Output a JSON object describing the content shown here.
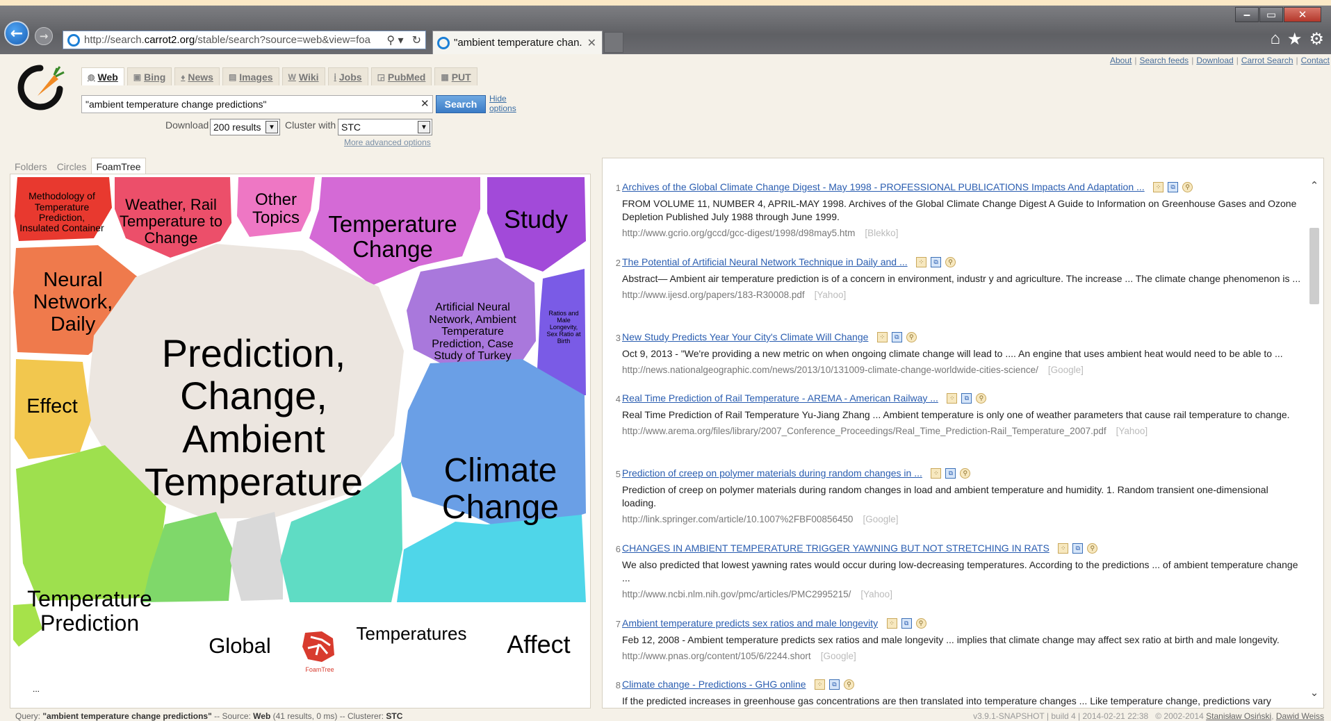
{
  "browser": {
    "address": "http://search.carrot2.org/stable/search?source=web&view=foa",
    "address_prefix": "http://search.",
    "address_host": "carrot2.org",
    "address_path": "/stable/search?source=web&view=foa",
    "tab_title": "\"ambient temperature chan...",
    "window_buttons": [
      "‒",
      "▭",
      "✕"
    ]
  },
  "top_links": [
    "About",
    "Search feeds",
    "Download",
    "Carrot Search",
    "Contact"
  ],
  "source_tabs": [
    {
      "label": "Web",
      "icon": "globe-icon",
      "active": true
    },
    {
      "label": "Bing",
      "icon": "bing-icon",
      "active": false
    },
    {
      "label": "News",
      "icon": "news-icon",
      "active": false
    },
    {
      "label": "Images",
      "icon": "images-icon",
      "active": false
    },
    {
      "label": "Wiki",
      "icon": "wiki-icon",
      "active": false
    },
    {
      "label": "Jobs",
      "icon": "jobs-icon",
      "active": false
    },
    {
      "label": "PubMed",
      "icon": "pubmed-icon",
      "active": false
    },
    {
      "label": "PUT",
      "icon": "put-icon",
      "active": false
    }
  ],
  "search": {
    "query": "\"ambient temperature change predictions\"",
    "button": "Search",
    "hide_options": "Hide options",
    "download_label": "Download",
    "download_value": "200 results",
    "cluster_label": "Cluster with",
    "cluster_value": "STC",
    "more_options": "More advanced options"
  },
  "view_tabs": [
    {
      "label": "Folders",
      "active": false
    },
    {
      "label": "Circles",
      "active": false
    },
    {
      "label": "FoamTree",
      "active": true
    }
  ],
  "foamtree": {
    "cells": [
      {
        "label": "Methodology of Temperature Prediction, Insulated Container",
        "color": "#e8392f"
      },
      {
        "label": "Weather, Rail Temperature to Change",
        "color": "#ec4f6a"
      },
      {
        "label": "Other Topics",
        "color": "#ee77c4"
      },
      {
        "label": "Temperature Change",
        "color": "#d46ad6"
      },
      {
        "label": "Study",
        "color": "#a24ad9"
      },
      {
        "label": "Neural Network, Daily",
        "color": "#ef7a4c"
      },
      {
        "label": "Prediction, Change, Ambient Temperature",
        "color": "#ece6e0"
      },
      {
        "label": "Artificial Neural Network, Ambient Temperature Prediction, Case Study of Turkey",
        "color": "#a978dc"
      },
      {
        "label": "Ratios and Male Longevity, Sex Ratio at Birth",
        "color": "#7a5be6"
      },
      {
        "label": "Effect",
        "color": "#f2c74e"
      },
      {
        "label": "Climate Change",
        "color": "#6a9fe6"
      },
      {
        "label": "Temperature Prediction",
        "color": "#9ee04e"
      },
      {
        "label": "Global",
        "color": "#7fd86a"
      },
      {
        "label": "Temperatures",
        "color": "#5fdcc4"
      },
      {
        "label": "Affect",
        "color": "#4fd6e9"
      },
      {
        "label": "...",
        "color": "#a6e24a"
      }
    ],
    "logo_text": "FoamTree"
  },
  "results": [
    {
      "num": "1",
      "title": "Archives of the Global Climate Change Digest - May 1998 - PROFESSIONAL PUBLICATIONS Impacts And Adaptation ...",
      "snippet": "FROM VOLUME 11, NUMBER 4, APRIL-MAY 1998. Archives of the Global Climate Change Digest A Guide to Information on Greenhouse Gases and Ozone Depletion Published July 1988 through June 1999.",
      "url": "http://www.gcrio.org/gccd/gcc-digest/1998/d98may5.htm",
      "source": "[Blekko]"
    },
    {
      "num": "2",
      "title": "The Potential of Artificial Neural Network Technique in Daily and ...",
      "snippet": "Abstract— Ambient air temperature prediction is of a concern in environment, industr y and agriculture. The increase ... The climate change phenomenon is ...",
      "url": "http://www.ijesd.org/papers/183-R30008.pdf",
      "source": "[Yahoo]"
    },
    {
      "num": "3",
      "title": "New Study Predicts Year Your City's Climate Will Change",
      "snippet": "Oct 9, 2013 - \"We're providing a new metric on when ongoing climate change will lead to .... An engine that uses ambient heat would need to be able to ...",
      "url": "http://news.nationalgeographic.com/news/2013/10/131009-climate-change-worldwide-cities-science/",
      "source": "[Google]"
    },
    {
      "num": "4",
      "title": "Real Time Prediction of Rail Temperature - AREMA - American Railway ...",
      "snippet": "Real Time Prediction of Rail Temperature Yu-Jiang Zhang ... Ambient temperature is only one of weather parameters that cause rail temperature to change.",
      "url": "http://www.arema.org/files/library/2007_Conference_Proceedings/Real_Time_Prediction-Rail_Temperature_2007.pdf",
      "source": "[Yahoo]"
    },
    {
      "num": "5",
      "title": "Prediction of creep on polymer materials during random changes in ...",
      "snippet": "Prediction of creep on polymer materials during random changes in load and ambient temperature and humidity. 1. Random transient one-dimensional loading.",
      "url": "http://link.springer.com/article/10.1007%2FBF00856450",
      "source": "[Google]"
    },
    {
      "num": "6",
      "title": "CHANGES IN AMBIENT TEMPERATURE TRIGGER YAWNING BUT NOT STRETCHING IN RATS",
      "snippet": "We also predicted that lowest yawning rates would occur during low-decreasing temperatures. According to the predictions ... of ambient temperature change ...",
      "url": "http://www.ncbi.nlm.nih.gov/pmc/articles/PMC2995215/",
      "source": "[Yahoo]"
    },
    {
      "num": "7",
      "title": "Ambient temperature predicts sex ratios and male longevity",
      "snippet": "Feb 12, 2008 - Ambient temperature predicts sex ratios and male longevity ... implies that climate change may affect sex ratio at birth and male longevity.",
      "url": "http://www.pnas.org/content/105/6/2244.short",
      "source": "[Google]"
    },
    {
      "num": "8",
      "title": "Climate change - Predictions - GHG online",
      "snippet": "If the predicted increases in greenhouse gas concentrations are then translated into temperature changes ... Like temperature change, predictions vary",
      "url": "",
      "source": ""
    }
  ],
  "status": {
    "query_label": "Query:",
    "query": "\"ambient temperature change predictions\"",
    "source_label": "-- Source:",
    "source": "Web",
    "source_detail": "(41 results, 0 ms)",
    "clusterer_label": "-- Clusterer:",
    "clusterer": "STC",
    "version": "v3.9.1-SNAPSHOT | build 4 | 2014-02-21 22:38",
    "copyright": "© 2002-2014",
    "author1": "Stanisław Osiński",
    "author2": "Dawid Weiss"
  }
}
